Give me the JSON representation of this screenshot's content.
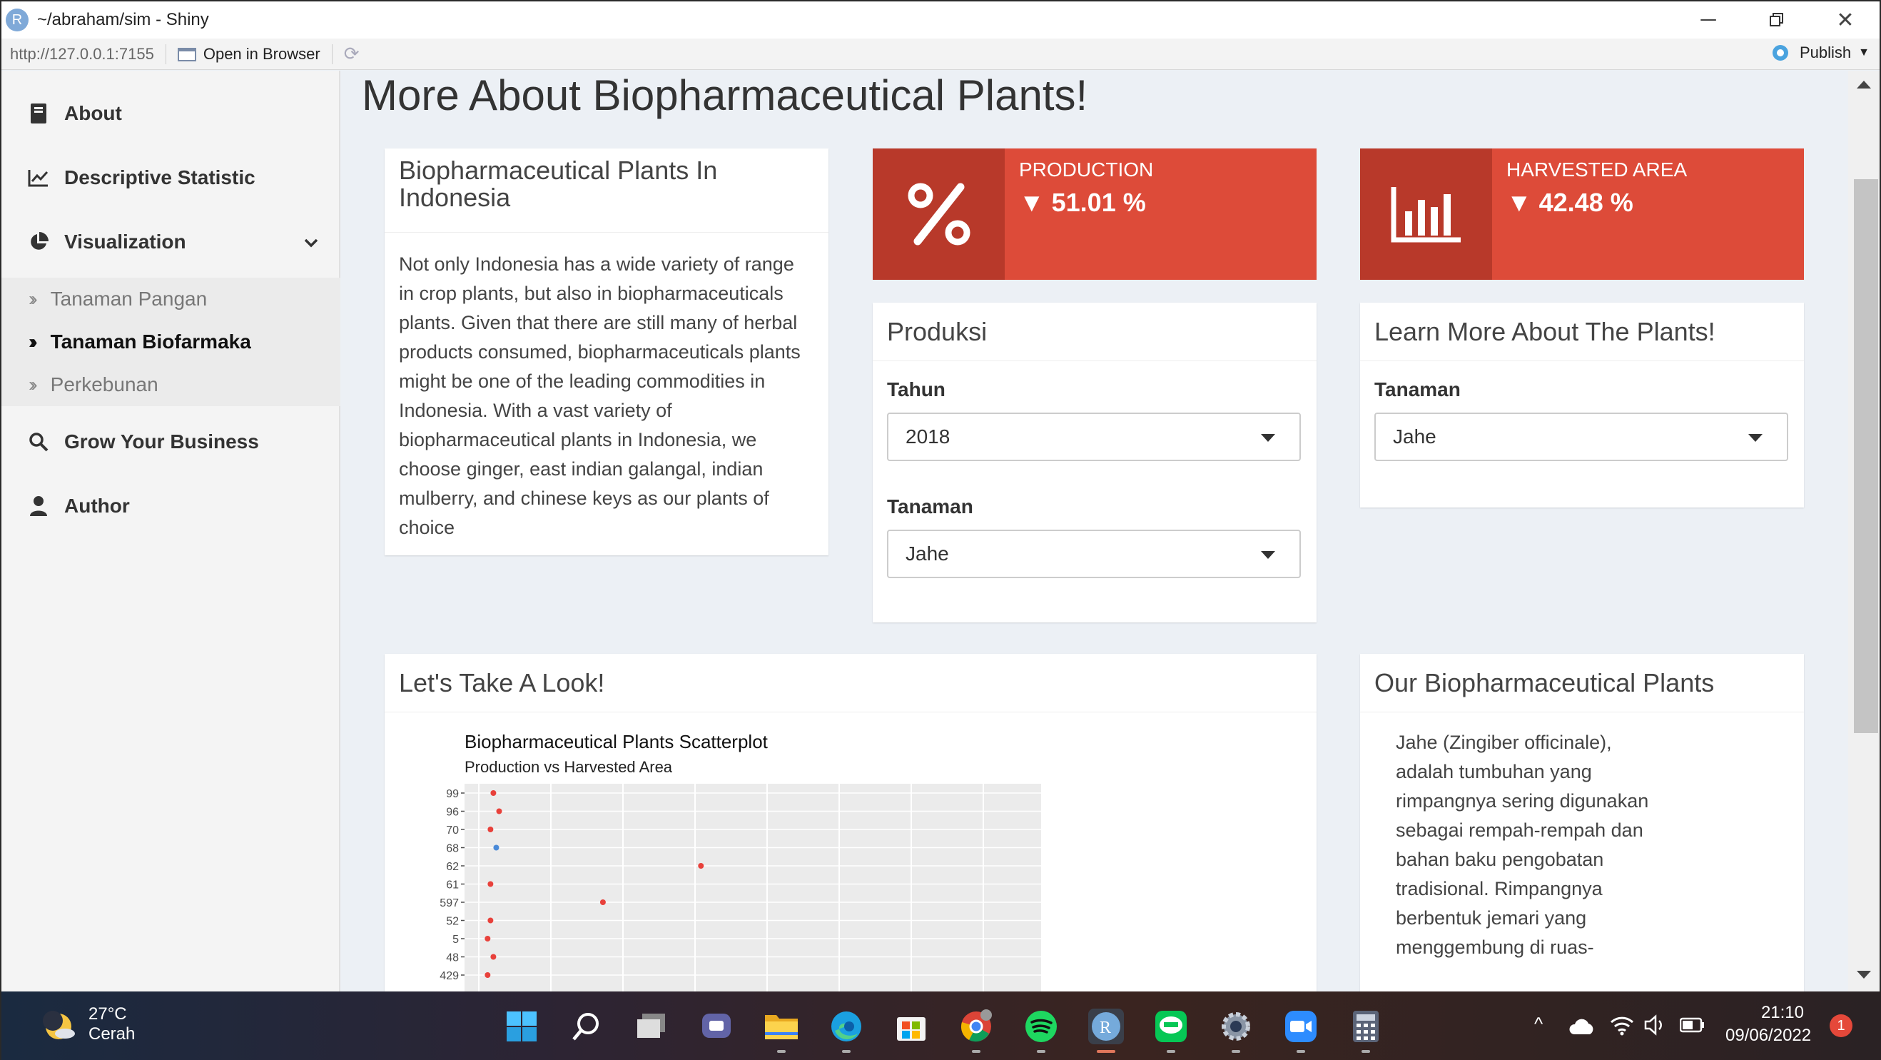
{
  "window": {
    "title": "~/abraham/sim - Shiny",
    "app_letter": "R"
  },
  "address_bar": {
    "url": "http://127.0.0.1:7155",
    "open_in_browser": "Open in Browser",
    "publish": "Publish"
  },
  "sidebar": {
    "items": [
      {
        "label": "About",
        "icon": "book-icon"
      },
      {
        "label": "Descriptive Statistic",
        "icon": "line-chart-icon"
      },
      {
        "label": "Visualization",
        "icon": "pie-chart-icon"
      },
      {
        "label": "Grow Your Business",
        "icon": "search-icon"
      },
      {
        "label": "Author",
        "icon": "user-icon"
      }
    ],
    "subitems": [
      {
        "label": "Tanaman Pangan",
        "active": false
      },
      {
        "label": "Tanaman Biofarmaka",
        "active": true
      },
      {
        "label": "Perkebunan",
        "active": false
      }
    ]
  },
  "main": {
    "title": "More About Biopharmaceutical Plants!",
    "intro_box": {
      "title": "Biopharmaceutical Plants In Indonesia",
      "text": "Not only Indonesia has a wide variety of range in crop plants, but also in biopharmaceuticals plants. Given that there are still many of herbal products consumed, biopharmaceuticals plants might be one of the leading commodities in Indonesia. With a vast variety of biopharmaceutical plants in Indonesia, we choose ginger, east indian galangal, indian mulberry, and chinese keys as our plants of choice"
    },
    "production_box": {
      "label": "Production",
      "value": "▼ 51.01 %",
      "icon": "percent-icon"
    },
    "harvest_box": {
      "label": "Harvested Area",
      "value": "▼ 42.48 %",
      "icon": "bar-chart-icon"
    },
    "produksi_box": {
      "title": "Produksi",
      "tahun_label": "Tahun",
      "tahun_value": "2018",
      "tanaman_label": "Tanaman",
      "tanaman_value": "Jahe"
    },
    "learn_box": {
      "title": "Learn More About The Plants!",
      "tanaman_label": "Tanaman",
      "tanaman_value": "Jahe"
    },
    "look_box": {
      "title": "Let's Take A Look!"
    },
    "plants_box": {
      "title": "Our Biopharmaceutical Plants",
      "text": "Jahe (Zingiber officinale), adalah tumbuhan yang rimpangnya sering digunakan sebagai rempah-rempah dan bahan baku pengobatan tradisional. Rimpangnya berbentuk jemari yang menggembung di ruas-"
    }
  },
  "chart_data": {
    "type": "scatter",
    "title": "Biopharmaceutical Plants Scatterplot",
    "subtitle": "Production vs Harvested Area",
    "y_tick_labels": [
      "99",
      "96",
      "70",
      "68",
      "62",
      "61",
      "597",
      "52",
      "5",
      "48",
      "429"
    ],
    "points": [
      {
        "y": "99",
        "x": 0.05,
        "color": "#e8413b"
      },
      {
        "y": "96",
        "x": 0.06,
        "color": "#e8413b"
      },
      {
        "y": "70",
        "x": 0.045,
        "color": "#e8413b"
      },
      {
        "y": "68",
        "x": 0.055,
        "color": "#4a8ad8"
      },
      {
        "y": "62",
        "x": 0.41,
        "color": "#e8413b"
      },
      {
        "y": "61",
        "x": 0.045,
        "color": "#e8413b"
      },
      {
        "y": "597",
        "x": 0.24,
        "color": "#e8413b"
      },
      {
        "y": "52",
        "x": 0.045,
        "color": "#e8413b"
      },
      {
        "y": "5",
        "x": 0.04,
        "color": "#e8413b"
      },
      {
        "y": "48",
        "x": 0.05,
        "color": "#e8413b"
      },
      {
        "y": "429",
        "x": 0.04,
        "color": "#e8413b"
      }
    ],
    "grid": true,
    "background": "#ebebeb"
  },
  "taskbar": {
    "weather_temp": "27°C",
    "weather_desc": "Cerah",
    "time": "21:10",
    "date": "09/06/2022",
    "notifications": "1",
    "apps": [
      "windows-start-icon",
      "search-icon",
      "task-view-icon",
      "teams-chat-icon",
      "file-explorer-icon",
      "edge-icon",
      "store-icon",
      "chrome-icon",
      "spotify-icon",
      "rstudio-icon",
      "line-icon",
      "settings-icon",
      "zoom-icon",
      "calculator-icon"
    ]
  },
  "colors": {
    "accent_red": "#dd4b39",
    "accent_red_dark": "#b8392a",
    "content_bg": "#ecf0f5",
    "sidebar_bg": "#f4f4f4"
  }
}
